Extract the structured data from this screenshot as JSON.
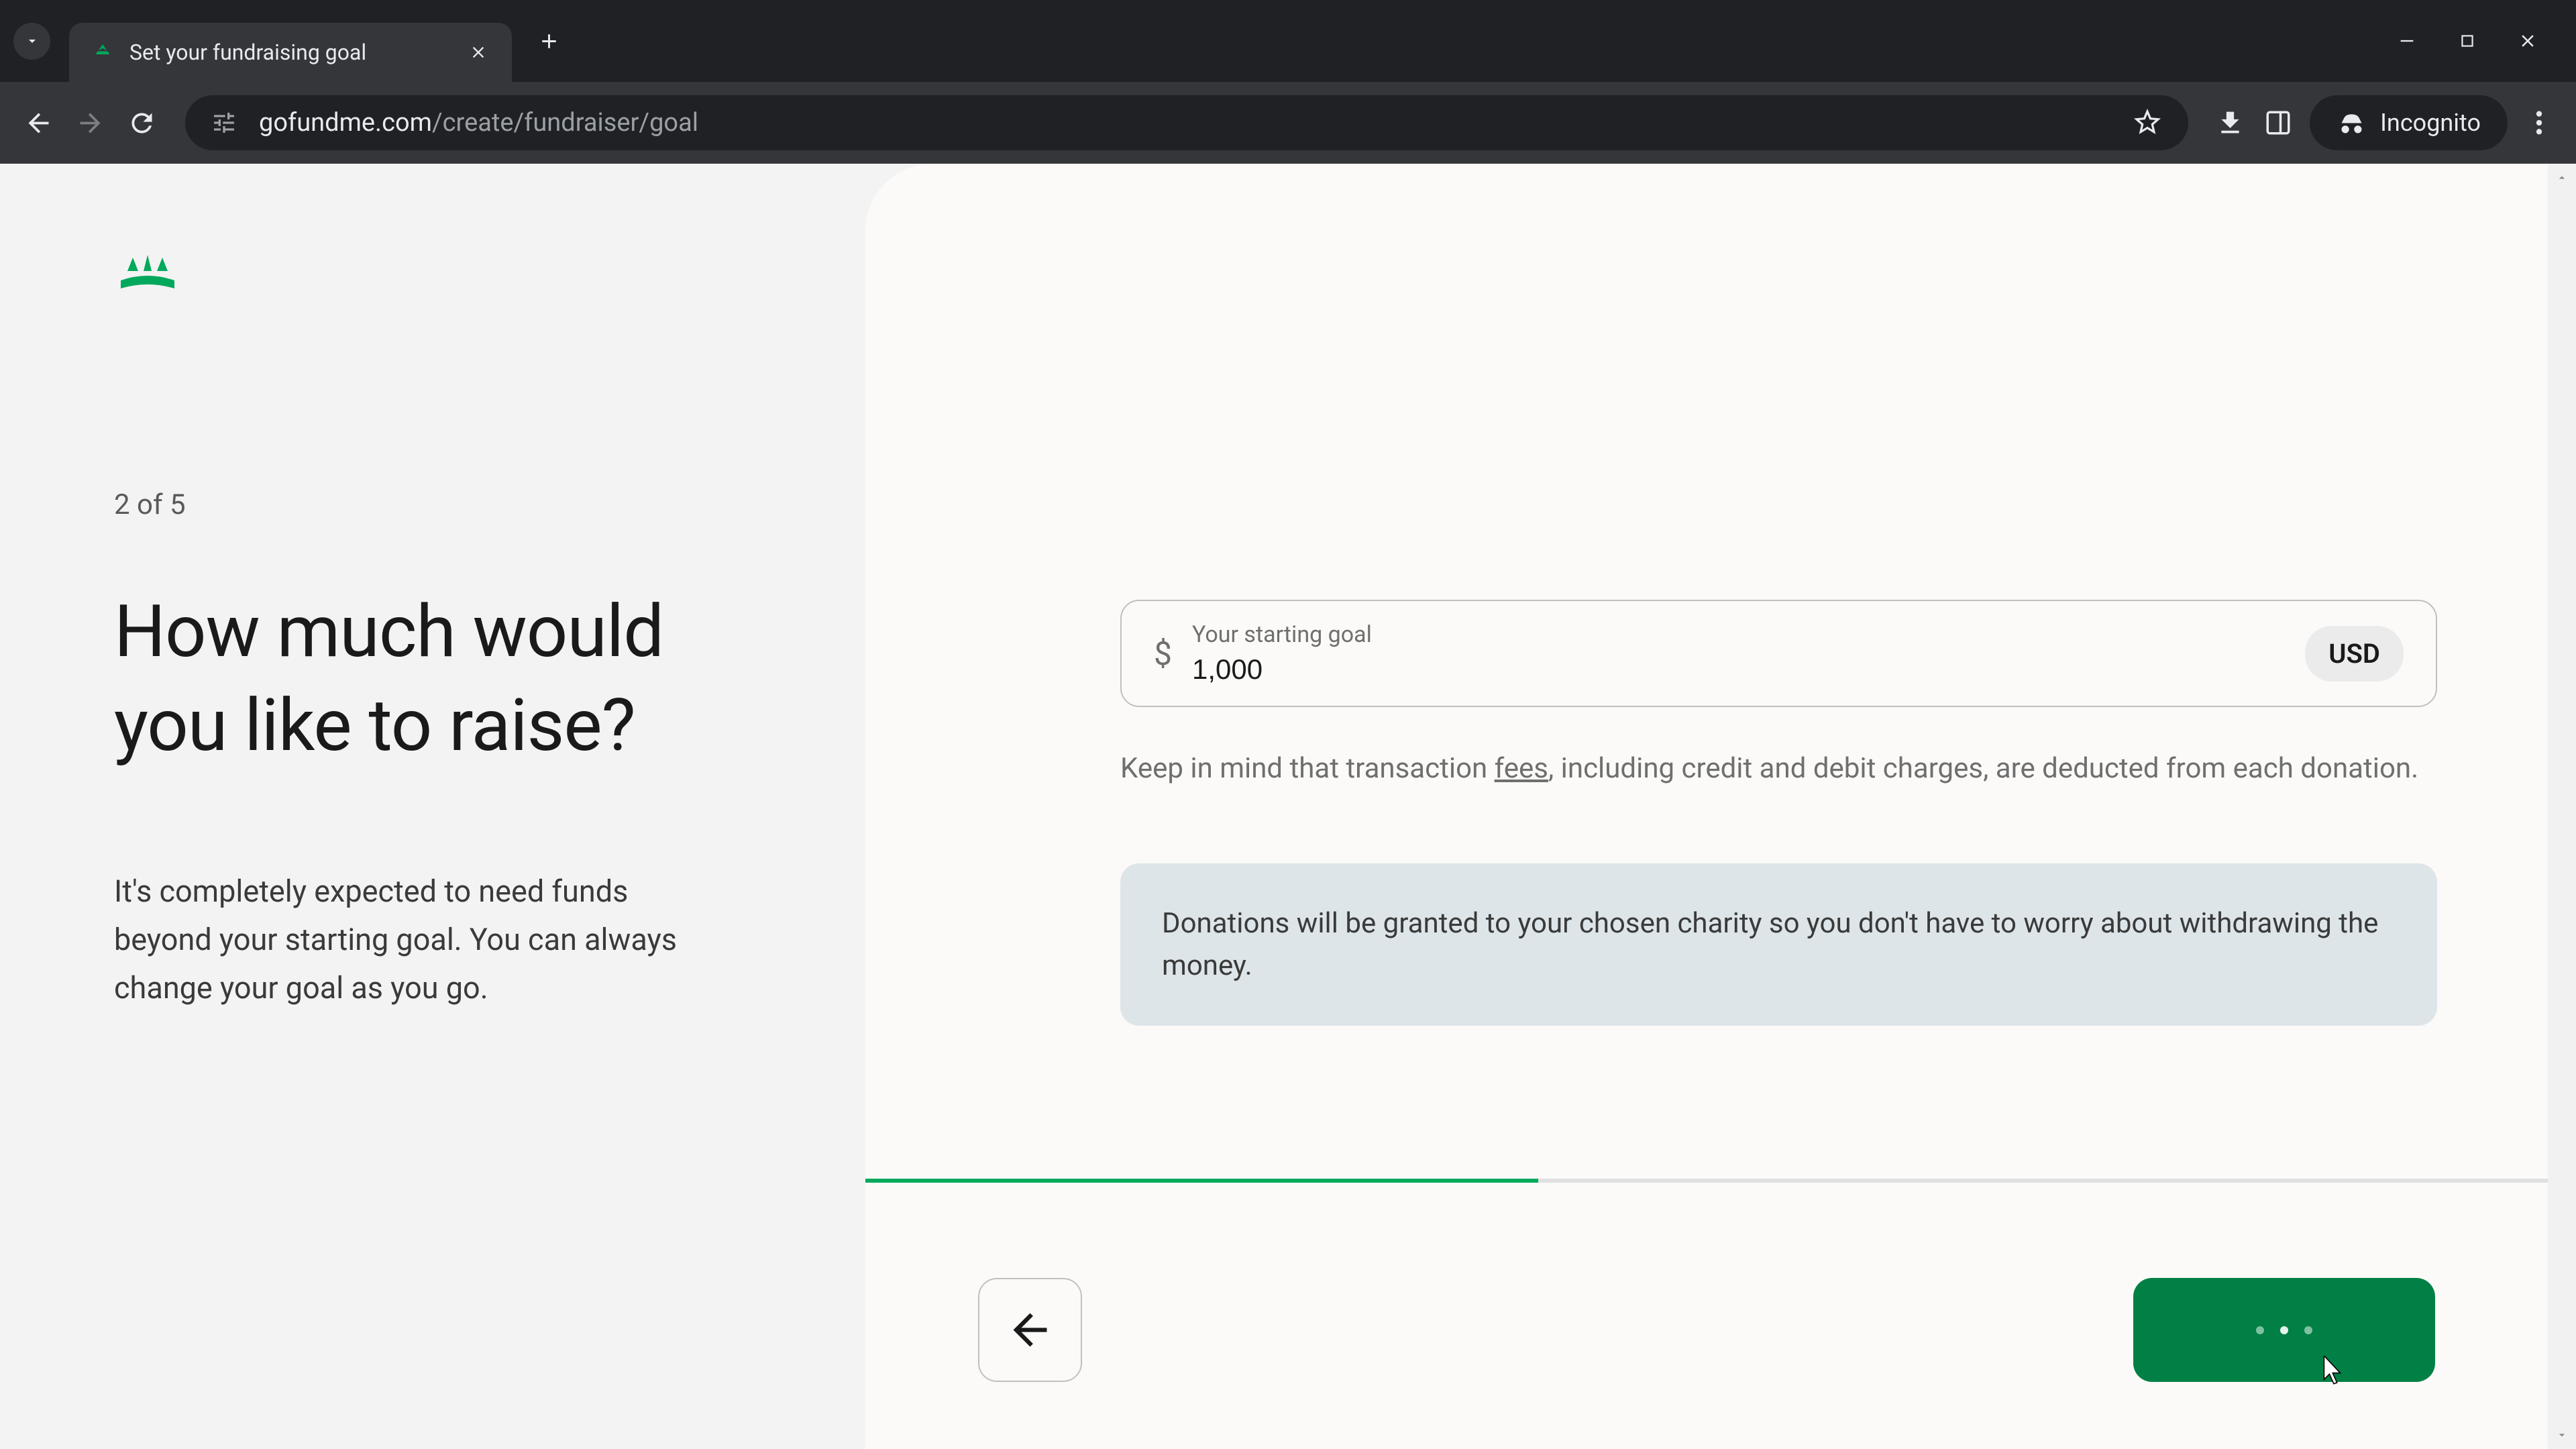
{
  "browser": {
    "tab_title": "Set your fundraising goal",
    "url_domain": "gofundme.com",
    "url_path": "/create/fundraiser/goal",
    "incognito_label": "Incognito"
  },
  "page": {
    "step_indicator": "2 of 5",
    "heading": "How much would you like to raise?",
    "description": "It's completely expected to need funds beyond your starting goal. You can always change your goal as you go."
  },
  "form": {
    "currency_symbol": "$",
    "input_label": "Your starting goal",
    "input_value": "1,000",
    "currency_code": "USD",
    "fees_note_before": "Keep in mind that transaction ",
    "fees_link": "fees",
    "fees_note_after": ", including credit and debit charges, are deducted from each donation.",
    "info_box": "Donations will be granted to your chosen charity so you don't have to worry about withdrawing the money."
  },
  "progress": {
    "percent": 40
  }
}
